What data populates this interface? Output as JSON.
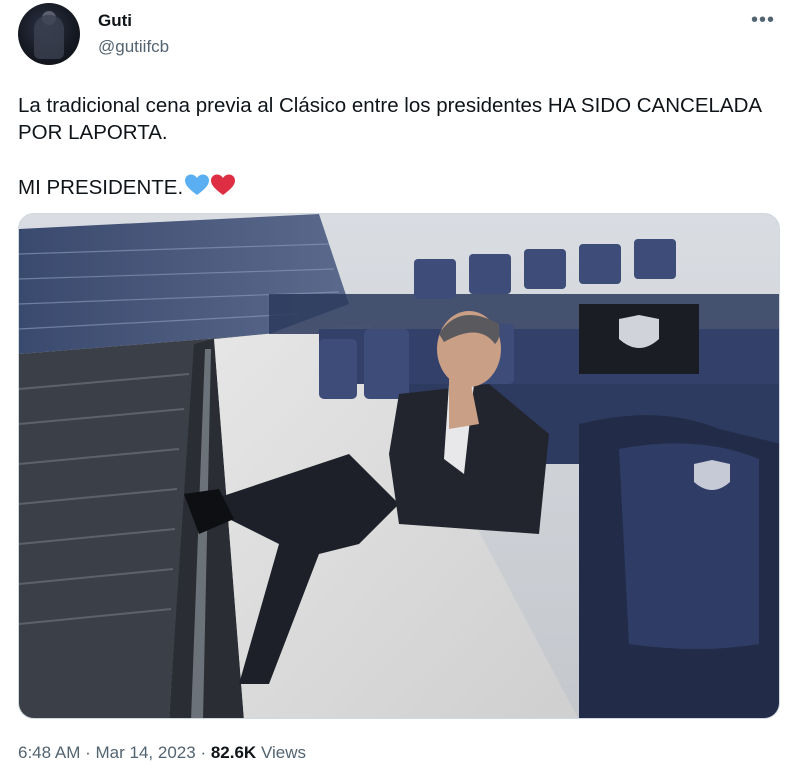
{
  "author": {
    "name": "Guti",
    "handle": "@gutiifcb"
  },
  "tweet": {
    "line1": "La tradicional cena previa al Clásico entre los presidentes HA SIDO CANCELADA POR LAPORTA.",
    "line2": "MI PRESIDENTE.",
    "emoji": [
      "blue-heart-icon",
      "red-heart-icon"
    ]
  },
  "footer": {
    "time": "6:48 AM",
    "separator": "·",
    "date": "Mar 14, 2023",
    "views_count": "82.6K",
    "views_label": "Views"
  },
  "colors": {
    "text_primary": "#0f1419",
    "text_secondary": "#536471",
    "heart_blue": "#5aaef2",
    "heart_red": "#dd2e44"
  }
}
